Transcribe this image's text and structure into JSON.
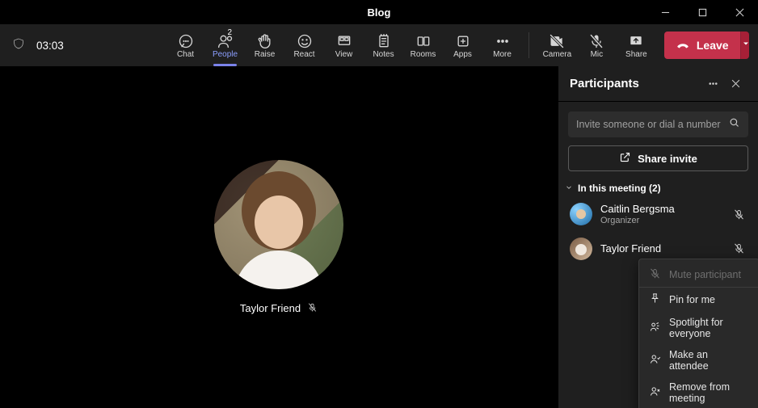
{
  "titlebar": {
    "title": "Blog"
  },
  "meeting": {
    "timer": "03:03"
  },
  "toolbar": {
    "items": [
      {
        "key": "chat",
        "label": "Chat"
      },
      {
        "key": "people",
        "label": "People",
        "badge": "2",
        "active": true
      },
      {
        "key": "raise",
        "label": "Raise"
      },
      {
        "key": "react",
        "label": "React"
      },
      {
        "key": "view",
        "label": "View"
      },
      {
        "key": "notes",
        "label": "Notes"
      },
      {
        "key": "rooms",
        "label": "Rooms"
      },
      {
        "key": "apps",
        "label": "Apps"
      },
      {
        "key": "more",
        "label": "More"
      }
    ],
    "right": [
      {
        "key": "camera",
        "label": "Camera"
      },
      {
        "key": "mic",
        "label": "Mic"
      },
      {
        "key": "share",
        "label": "Share"
      }
    ],
    "leave_label": "Leave"
  },
  "stage": {
    "participant_name": "Taylor Friend"
  },
  "panel": {
    "title": "Participants",
    "search_placeholder": "Invite someone or dial a number",
    "share_invite_label": "Share invite",
    "section_label": "In this meeting (2)",
    "people": [
      {
        "name": "Caitlin Bergsma",
        "role": "Organizer",
        "muted": true
      },
      {
        "name": "Taylor Friend",
        "role": "",
        "muted": true
      }
    ]
  },
  "context_menu": {
    "items": [
      {
        "label": "Mute participant",
        "disabled": true
      },
      {
        "label": "Pin for me"
      },
      {
        "label": "Spotlight for everyone"
      },
      {
        "label": "Make an attendee"
      },
      {
        "label": "Remove from meeting"
      }
    ]
  }
}
